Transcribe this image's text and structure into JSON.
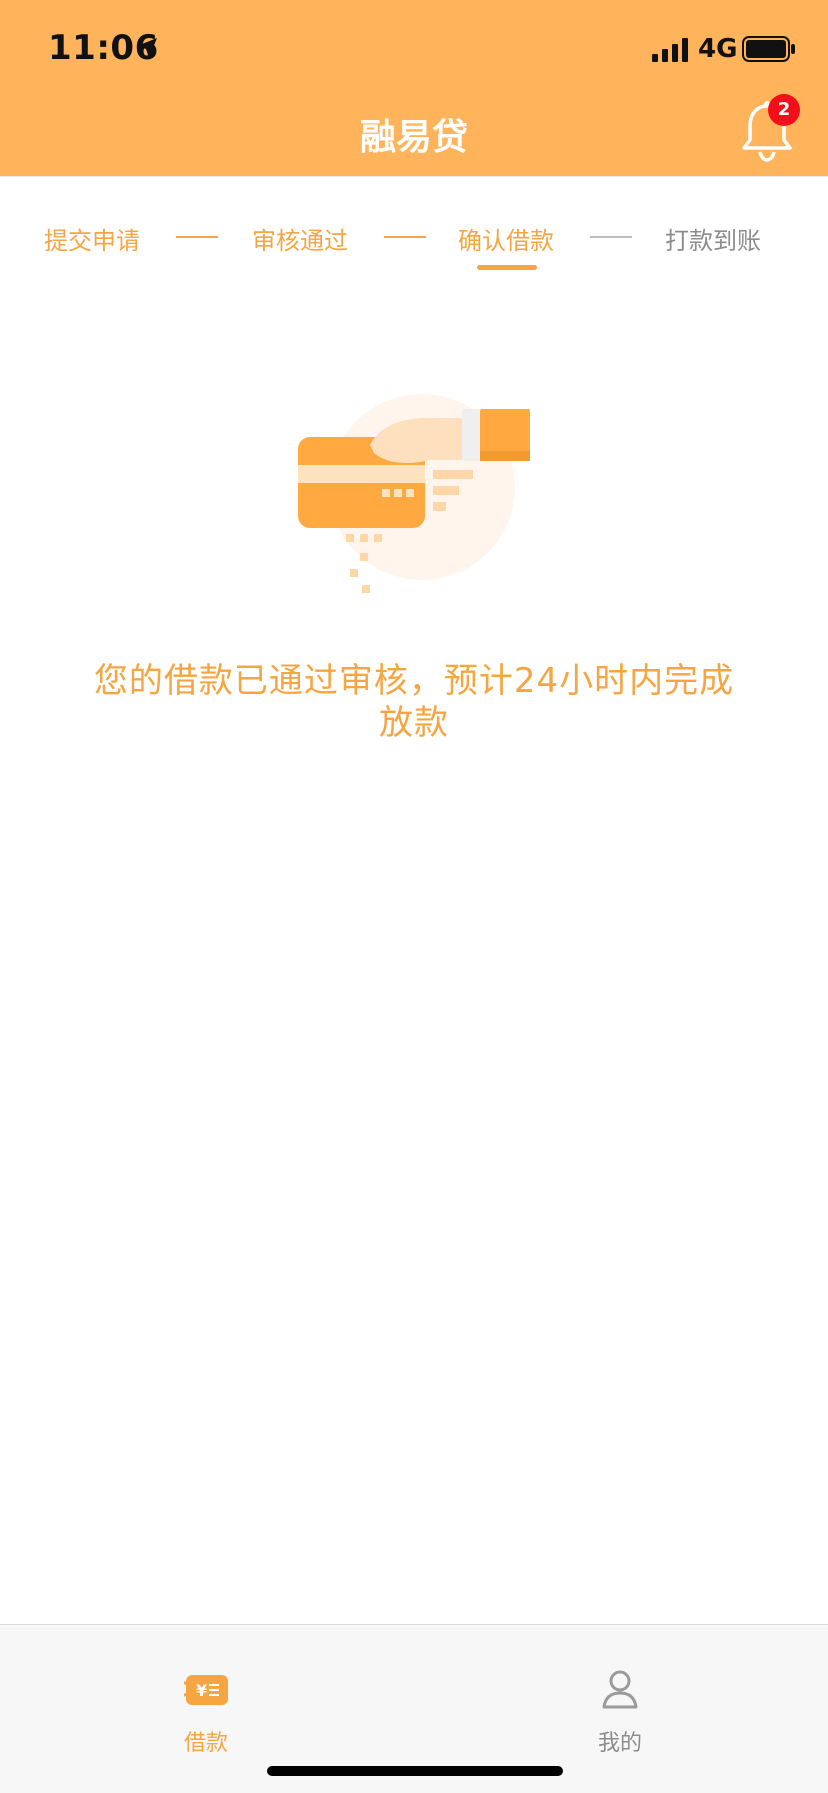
{
  "status_bar": {
    "time": "11:06",
    "network": "4G"
  },
  "header": {
    "title": "融易贷",
    "notification_count": "2"
  },
  "steps": [
    {
      "label": "提交申请",
      "state": "done"
    },
    {
      "label": "审核通过",
      "state": "done"
    },
    {
      "label": "确认借款",
      "state": "current"
    },
    {
      "label": "打款到账",
      "state": "pending"
    }
  ],
  "main": {
    "message": "您的借款已通过审核，预计24小时内完成放款"
  },
  "tabbar": {
    "tabs": [
      {
        "label": "借款",
        "active": true,
        "icon": "loan-icon"
      },
      {
        "label": "我的",
        "active": false,
        "icon": "user-icon"
      }
    ]
  },
  "colors": {
    "brand": "#FFB45B",
    "accent": "#F6A542",
    "badge": "#F20F1A",
    "inactive": "#8C8C8C"
  }
}
